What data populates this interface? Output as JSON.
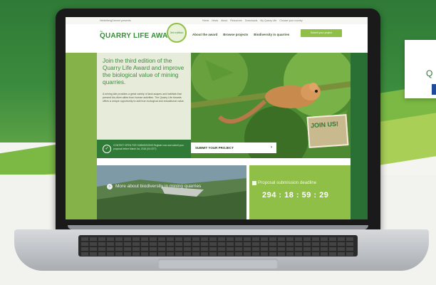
{
  "topbar": {
    "left_text": "HeidelbergCement presents",
    "nav": [
      "Home",
      "News",
      "About",
      "Resources",
      "Downloads",
      "My Quarry Life",
      "Choose your country"
    ]
  },
  "header": {
    "logo_prefix": "the",
    "logo": "QUARRY LIFE AWARD",
    "badge": "3rd edition",
    "menu": [
      "About the award",
      "Browse projects",
      "Biodiversity in quarries"
    ],
    "submit_button": "Submit your project"
  },
  "hero": {
    "title": "Join the third edition of the Quarry Life Award and improve the biological value of mining quarries.",
    "body": "A mining site provides a great variety of land-scapes and habitats that present bio-diver-sities from human activities. The Quarry Life Awards offers a unique opportunity to add true ecological and educational value.",
    "status": "CONTEST OPEN FOR SUBMISSIONS Register now and submit your proposal before March 1st, 2018 (XX:CET)",
    "cta": "SUBMIT YOUR PROJECT",
    "join": "JOIN US!"
  },
  "quarry_section": {
    "link": "More about biodiversity in mining quarries"
  },
  "deadline": {
    "label": "Proposal submission deadline",
    "countdown": "294 : 18 : 59 : 29"
  },
  "side_card": {
    "letter": "Q"
  },
  "colors": {
    "brand_green": "#3b8b3d",
    "light_green": "#8fbf46",
    "dark_green": "#2f7a37"
  }
}
